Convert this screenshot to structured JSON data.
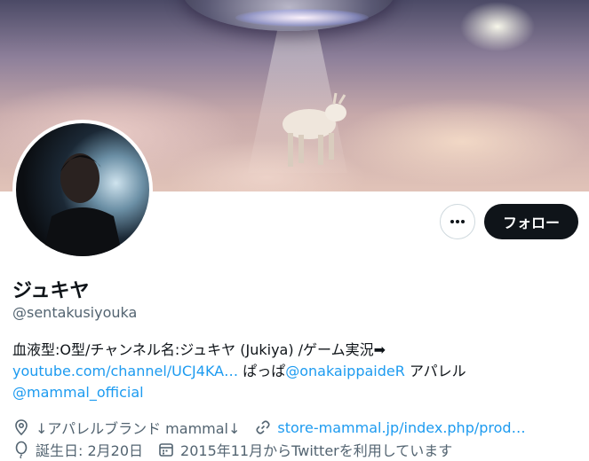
{
  "profile": {
    "display_name": "ジュキヤ",
    "handle": "@sentakusiyouka",
    "bio": {
      "line1": "血液型:O型/チャンネル名:ジュキヤ (Jukiya) /ゲーム実況➡",
      "link1": "youtube.com/channel/UCJ4KA…",
      "text_after_link1": " ぱっぱ",
      "mention1": "@onakaippaideR",
      "text_after_mention1": " アパレル",
      "mention2": "@mammal_official"
    },
    "location": "↓アパレルブランド mammal↓",
    "website": "store-mammal.jp/index.php/prod…",
    "birthday": "誕生日: 2月20日",
    "joined": "2015年11月からTwitterを利用しています"
  },
  "actions": {
    "follow_label": "フォロー",
    "more_icon": "more-horizontal-icon"
  },
  "icons": {
    "location": "location-pin-icon",
    "website": "link-icon",
    "birthday": "balloon-icon",
    "joined": "calendar-icon"
  },
  "colors": {
    "link": "#1d9bf0",
    "secondary_text": "#536471",
    "button_dark": "#0f1419"
  }
}
